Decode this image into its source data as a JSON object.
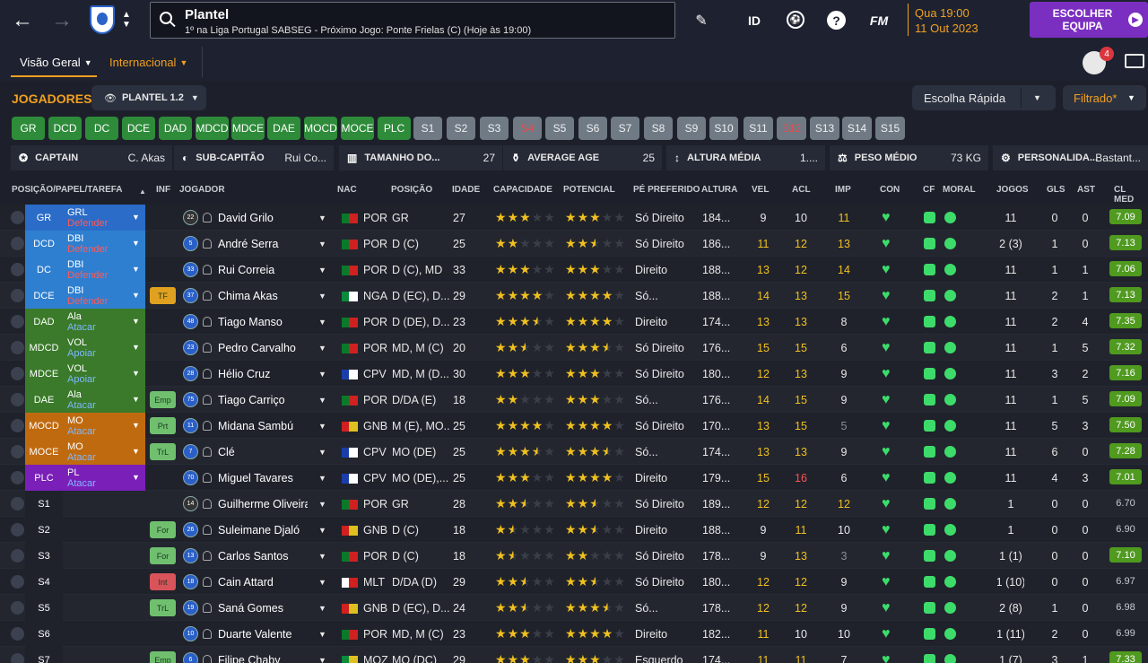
{
  "header": {
    "title": "Plantel",
    "subtitle": "1º na Liga Portugal SABSEG - Próximo Jogo: Ponte Frielas (C) (Hoje às 19:00)",
    "date_line1": "Qua 19:00",
    "date_line2": "11 Out 2023",
    "choose_team": "ESCOLHER EQUIPA",
    "id_label": "ID",
    "fm_label": "FM",
    "notif_count": "4"
  },
  "tabs": {
    "overview": "Visão Geral",
    "international": "Internacional"
  },
  "squad": {
    "title": "JOGADORES",
    "plantel": "PLANTEL 1.2",
    "quick": "Escolha Rápida",
    "filter": "Filtrado*"
  },
  "positions": [
    {
      "l": "GR",
      "t": "g"
    },
    {
      "l": "DCD",
      "t": "g"
    },
    {
      "l": "DC",
      "t": "g"
    },
    {
      "l": "DCE",
      "t": "g"
    },
    {
      "l": "DAD",
      "t": "g"
    },
    {
      "l": "MDCD",
      "t": "g"
    },
    {
      "l": "MDCE",
      "t": "g"
    },
    {
      "l": "DAE",
      "t": "g"
    },
    {
      "l": "MOCD",
      "t": "g"
    },
    {
      "l": "MOCE",
      "t": "g"
    },
    {
      "l": "PLC",
      "t": "g"
    },
    {
      "l": "S1",
      "t": "s"
    },
    {
      "l": "S2",
      "t": "s"
    },
    {
      "l": "S3",
      "t": "s"
    },
    {
      "l": "S4",
      "t": "r"
    },
    {
      "l": "S5",
      "t": "s"
    },
    {
      "l": "S6",
      "t": "s"
    },
    {
      "l": "S7",
      "t": "s"
    },
    {
      "l": "S8",
      "t": "s"
    },
    {
      "l": "S9",
      "t": "s"
    },
    {
      "l": "S10",
      "t": "s"
    },
    {
      "l": "S11",
      "t": "s"
    },
    {
      "l": "S12",
      "t": "r"
    },
    {
      "l": "S13",
      "t": "s"
    },
    {
      "l": "S14",
      "t": "s"
    },
    {
      "l": "S15",
      "t": "s"
    }
  ],
  "info": {
    "captain_l": "CAPTAIN",
    "captain_v": "C. Akas",
    "vice_l": "SUB-CAPITÃO",
    "vice_v": "Rui Co...",
    "size_l": "TAMANHO DO...",
    "size_v": "27",
    "age_l": "AVERAGE AGE",
    "age_v": "25",
    "height_l": "ALTURA MÉDIA",
    "height_v": "1....",
    "weight_l": "PESO MÉDIO",
    "weight_v": "73 KG",
    "pers_l": "PERSONALIDA...",
    "pers_v": "Bastant..."
  },
  "columns": {
    "pos": "POSIÇÃO/PAPEL/TAREFA",
    "inf": "INF",
    "player": "JOGADOR",
    "nac": "NAC",
    "position": "POSIÇÃO",
    "age": "IDADE",
    "cap": "CAPACIDADE",
    "pot": "POTENCIAL",
    "foot": "PÉ PREFERIDO",
    "height": "ALTURA",
    "vel": "VEL",
    "acl": "ACL",
    "imp": "IMP",
    "con": "CON",
    "cf": "CF",
    "moral": "MORAL",
    "games": "JOGOS",
    "gls": "GLS",
    "ast": "AST",
    "clmed": "CL MED"
  },
  "rows": [
    {
      "slot": "GR",
      "role": "GRL",
      "duty": "Defender",
      "inf": "",
      "num": "22",
      "name": "David Grilo",
      "nat": "POR",
      "flag": "por",
      "pos": "GR",
      "age": "27",
      "cap": 3,
      "pot": 3,
      "foot": "Só Direito",
      "h": "184...",
      "vel": "9",
      "acl": "10",
      "imp": "11",
      "imp_c": "y",
      "vel_c": "",
      "acl_c": "",
      "games": "11",
      "gls": "0",
      "ast": "0",
      "cl": "7.09",
      "clg": true
    },
    {
      "slot": "DCD",
      "role": "DBI",
      "duty": "Defender",
      "inf": "",
      "num": "5",
      "name": "André Serra",
      "nat": "POR",
      "flag": "por",
      "pos": "D (C)",
      "age": "25",
      "cap": 2,
      "pot": 2.5,
      "foot": "Só Direito",
      "h": "186...",
      "vel": "11",
      "acl": "12",
      "imp": "13",
      "imp_c": "y",
      "vel_c": "y",
      "acl_c": "y",
      "games": "2 (3)",
      "gls": "1",
      "ast": "0",
      "cl": "7.13",
      "clg": true
    },
    {
      "slot": "DC",
      "role": "DBI",
      "duty": "Defender",
      "inf": "",
      "num": "33",
      "name": "Rui Correia",
      "nat": "POR",
      "flag": "por",
      "pos": "D (C), MD",
      "age": "33",
      "cap": 3,
      "pot": 3,
      "foot": "Direito",
      "h": "188...",
      "vel": "13",
      "acl": "12",
      "imp": "14",
      "imp_c": "y",
      "vel_c": "y",
      "acl_c": "y",
      "games": "11",
      "gls": "1",
      "ast": "1",
      "cl": "7.06",
      "clg": true
    },
    {
      "slot": "DCE",
      "role": "DBI",
      "duty": "Defender",
      "inf": "TF",
      "num": "37",
      "name": "Chima Akas",
      "nat": "NGA",
      "flag": "nga",
      "pos": "D (EC), D...",
      "age": "29",
      "cap": 4,
      "pot": 4,
      "foot": "Só...",
      "h": "188...",
      "vel": "14",
      "acl": "13",
      "imp": "15",
      "imp_c": "y",
      "vel_c": "y",
      "acl_c": "y",
      "games": "11",
      "gls": "2",
      "ast": "1",
      "cl": "7.13",
      "clg": true
    },
    {
      "slot": "DAD",
      "role": "Ala",
      "duty": "Atacar",
      "inf": "",
      "num": "48",
      "name": "Tiago Manso",
      "nat": "POR",
      "flag": "por",
      "pos": "D (DE), D...",
      "age": "23",
      "cap": 3.5,
      "pot": 4,
      "foot": "Direito",
      "h": "174...",
      "vel": "13",
      "acl": "13",
      "imp": "8",
      "imp_c": "",
      "vel_c": "y",
      "acl_c": "y",
      "games": "11",
      "gls": "2",
      "ast": "4",
      "cl": "7.35",
      "clg": true
    },
    {
      "slot": "MDCD",
      "role": "VOL",
      "duty": "Apoiar",
      "inf": "",
      "num": "23",
      "name": "Pedro Carvalho",
      "nat": "POR",
      "flag": "por",
      "pos": "MD, M (C)",
      "age": "20",
      "cap": 2.5,
      "pot": 3.5,
      "foot": "Só Direito",
      "h": "176...",
      "vel": "15",
      "acl": "15",
      "imp": "6",
      "imp_c": "",
      "vel_c": "y",
      "acl_c": "y",
      "games": "11",
      "gls": "1",
      "ast": "5",
      "cl": "7.32",
      "clg": true
    },
    {
      "slot": "MDCE",
      "role": "VOL",
      "duty": "Apoiar",
      "inf": "",
      "num": "28",
      "name": "Hélio Cruz",
      "nat": "CPV",
      "flag": "cpv",
      "pos": "MD, M (D...",
      "age": "30",
      "cap": 3,
      "pot": 3,
      "foot": "Só Direito",
      "h": "180...",
      "vel": "12",
      "acl": "13",
      "imp": "9",
      "imp_c": "",
      "vel_c": "y",
      "acl_c": "y",
      "games": "11",
      "gls": "3",
      "ast": "2",
      "cl": "7.16",
      "clg": true
    },
    {
      "slot": "DAE",
      "role": "Ala",
      "duty": "Atacar",
      "inf": "Emp",
      "num": "75",
      "name": "Tiago Carriço",
      "nat": "POR",
      "flag": "por",
      "pos": "D/DA (E)",
      "age": "18",
      "cap": 2,
      "pot": 3,
      "foot": "Só...",
      "h": "176...",
      "vel": "14",
      "acl": "15",
      "imp": "9",
      "imp_c": "",
      "vel_c": "y",
      "acl_c": "y",
      "games": "11",
      "gls": "1",
      "ast": "5",
      "cl": "7.09",
      "clg": true
    },
    {
      "slot": "MOCD",
      "role": "MO",
      "duty": "Atacar",
      "inf": "Prt",
      "num": "11",
      "name": "Midana Sambú",
      "nat": "GNB",
      "flag": "gnb",
      "pos": "M (E), MO...",
      "age": "25",
      "cap": 4,
      "pot": 4,
      "foot": "Só Direito",
      "h": "170...",
      "vel": "13",
      "acl": "15",
      "imp": "5",
      "imp_c": "g",
      "vel_c": "y",
      "acl_c": "y",
      "games": "11",
      "gls": "5",
      "ast": "3",
      "cl": "7.50",
      "clg": true
    },
    {
      "slot": "MOCE",
      "role": "MO",
      "duty": "Atacar",
      "inf": "TrL",
      "num": "7",
      "name": "Clé",
      "nat": "CPV",
      "flag": "cpv",
      "pos": "MO (DE)",
      "age": "25",
      "cap": 3.5,
      "pot": 3.5,
      "foot": "Só...",
      "h": "174...",
      "vel": "13",
      "acl": "13",
      "imp": "9",
      "imp_c": "",
      "vel_c": "y",
      "acl_c": "y",
      "games": "11",
      "gls": "6",
      "ast": "0",
      "cl": "7.28",
      "clg": true
    },
    {
      "slot": "PLC",
      "role": "PL",
      "duty": "Atacar",
      "inf": "",
      "num": "70",
      "name": "Miguel Tavares",
      "nat": "CPV",
      "flag": "cpv",
      "pos": "MO (DE),...",
      "age": "25",
      "cap": 3,
      "pot": 4,
      "foot": "Direito",
      "h": "179...",
      "vel": "15",
      "acl": "16",
      "imp": "6",
      "imp_c": "",
      "vel_c": "y",
      "acl_c": "r",
      "games": "11",
      "gls": "4",
      "ast": "3",
      "cl": "7.01",
      "clg": true
    },
    {
      "slot": "S1",
      "role": "",
      "duty": "",
      "inf": "",
      "num": "14",
      "name": "Guilherme Oliveira",
      "nat": "POR",
      "flag": "por",
      "pos": "GR",
      "age": "28",
      "cap": 2.5,
      "pot": 2.5,
      "foot": "Só Direito",
      "h": "189...",
      "vel": "12",
      "acl": "12",
      "imp": "12",
      "imp_c": "y",
      "vel_c": "y",
      "acl_c": "y",
      "games": "1",
      "gls": "0",
      "ast": "0",
      "cl": "6.70",
      "clg": false
    },
    {
      "slot": "S2",
      "role": "",
      "duty": "",
      "inf": "For",
      "num": "26",
      "name": "Suleimane Djaló",
      "nat": "GNB",
      "flag": "gnb",
      "pos": "D (C)",
      "age": "18",
      "cap": 1.5,
      "pot": 2.5,
      "foot": "Direito",
      "h": "188...",
      "vel": "9",
      "acl": "11",
      "imp": "10",
      "imp_c": "",
      "vel_c": "",
      "acl_c": "y",
      "games": "1",
      "gls": "0",
      "ast": "0",
      "cl": "6.90",
      "clg": false
    },
    {
      "slot": "S3",
      "role": "",
      "duty": "",
      "inf": "For",
      "num": "13",
      "name": "Carlos Santos",
      "nat": "POR",
      "flag": "por",
      "pos": "D (C)",
      "age": "18",
      "cap": 1.5,
      "pot": 2,
      "foot": "Só Direito",
      "h": "178...",
      "vel": "9",
      "acl": "13",
      "imp": "3",
      "imp_c": "g",
      "vel_c": "",
      "acl_c": "y",
      "games": "1 (1)",
      "gls": "0",
      "ast": "0",
      "cl": "7.10",
      "clg": true
    },
    {
      "slot": "S4",
      "role": "",
      "duty": "",
      "inf": "Int",
      "num": "18",
      "name": "Cain Attard",
      "nat": "MLT",
      "flag": "mlt",
      "pos": "D/DA (D)",
      "age": "29",
      "cap": 2.5,
      "pot": 2.5,
      "foot": "Só Direito",
      "h": "180...",
      "vel": "12",
      "acl": "12",
      "imp": "9",
      "imp_c": "",
      "vel_c": "y",
      "acl_c": "y",
      "games": "1 (10)",
      "gls": "0",
      "ast": "0",
      "cl": "6.97",
      "clg": false
    },
    {
      "slot": "S5",
      "role": "",
      "duty": "",
      "inf": "TrL",
      "num": "19",
      "name": "Saná Gomes",
      "nat": "GNB",
      "flag": "gnb",
      "pos": "D (EC), D...",
      "age": "24",
      "cap": 2.5,
      "pot": 3.5,
      "foot": "Só...",
      "h": "178...",
      "vel": "12",
      "acl": "12",
      "imp": "9",
      "imp_c": "",
      "vel_c": "y",
      "acl_c": "y",
      "games": "2 (8)",
      "gls": "1",
      "ast": "0",
      "cl": "6.98",
      "clg": false
    },
    {
      "slot": "S6",
      "role": "",
      "duty": "",
      "inf": "",
      "num": "10",
      "name": "Duarte Valente",
      "nat": "POR",
      "flag": "por",
      "pos": "MD, M (C)",
      "age": "23",
      "cap": 3,
      "pot": 4,
      "foot": "Direito",
      "h": "182...",
      "vel": "11",
      "acl": "10",
      "imp": "10",
      "imp_c": "",
      "vel_c": "y",
      "acl_c": "",
      "games": "1 (11)",
      "gls": "2",
      "ast": "0",
      "cl": "6.99",
      "clg": false
    },
    {
      "slot": "S7",
      "role": "",
      "duty": "",
      "inf": "Emp",
      "num": "6",
      "name": "Filipe Chaby",
      "nat": "MOZ",
      "flag": "moz",
      "pos": "MO (DC)",
      "age": "29",
      "cap": 3,
      "pot": 3,
      "foot": "Esquerdo",
      "h": "174...",
      "vel": "11",
      "acl": "11",
      "imp": "7",
      "imp_c": "",
      "vel_c": "y",
      "acl_c": "y",
      "games": "1 (7)",
      "gls": "3",
      "ast": "1",
      "cl": "7.33",
      "clg": true
    }
  ]
}
